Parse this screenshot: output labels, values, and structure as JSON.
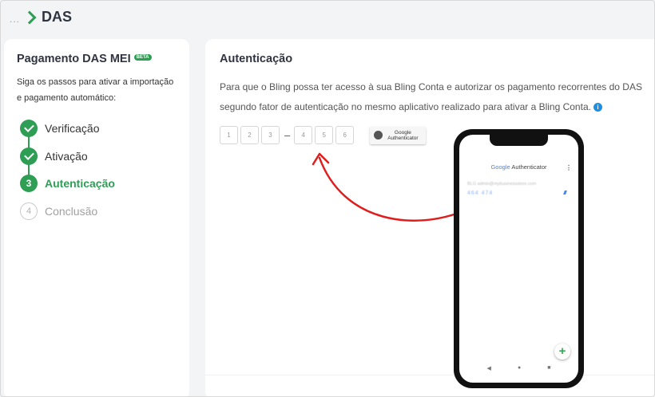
{
  "header": {
    "breadcrumb_ellipsis": "...",
    "title": "DAS"
  },
  "sidebar": {
    "title": "Pagamento DAS MEI",
    "badge": "BETA",
    "description": "Siga os passos para ativar a importação e pagamento automático:",
    "steps": [
      {
        "label": "Verificação",
        "status": "done"
      },
      {
        "label": "Ativação",
        "status": "done"
      },
      {
        "number": "3",
        "label": "Autenticação",
        "status": "active"
      },
      {
        "number": "4",
        "label": "Conclusão",
        "status": "pending"
      }
    ]
  },
  "main": {
    "title": "Autenticação",
    "paragraph_line1": "Para que o Bling possa ter acesso à sua Bling Conta e autorizar os pagamento recorrentes do DAS",
    "paragraph_line2": "segundo fator de autenticação no mesmo aplicativo realizado para ativar a Bling Conta.",
    "info_icon": "i",
    "code_digits": [
      "1",
      "2",
      "3",
      "4",
      "5",
      "6"
    ],
    "code_separator": "–",
    "authenticator_badge": {
      "line1": "Google",
      "line2": "Authenticator"
    }
  },
  "phone": {
    "app_title_brand": "Google",
    "app_title_rest": " Authenticator",
    "menu_icon": "⋮",
    "account_line": "BLG admin@mybusinessstore.com",
    "code": "464 474",
    "fab_label": "+",
    "nav": {
      "back": "◀",
      "home": "●",
      "recent": "■"
    }
  },
  "colors": {
    "accent": "#2e9e55",
    "arrow": "#e01e1e",
    "info": "#1d8fe0"
  }
}
